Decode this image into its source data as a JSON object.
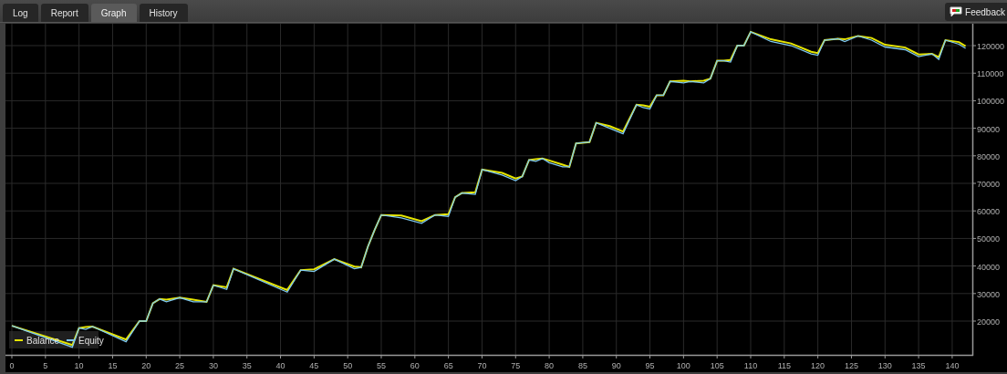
{
  "tabs": [
    {
      "label": "Log",
      "selected": false
    },
    {
      "label": "Report",
      "selected": false
    },
    {
      "label": "Graph",
      "selected": true
    },
    {
      "label": "History",
      "selected": false
    }
  ],
  "feedback_button": {
    "label": "Feedback"
  },
  "chart_data": {
    "type": "line",
    "x": [
      0,
      9,
      10,
      11,
      12,
      17,
      19,
      20,
      21,
      22,
      23,
      25,
      27,
      29,
      30,
      32,
      33,
      41,
      43,
      45,
      48,
      51,
      52,
      53,
      54,
      55,
      58,
      61,
      63,
      65,
      66,
      67,
      69,
      70,
      73,
      75,
      76,
      77,
      78,
      79,
      80,
      82,
      83,
      84,
      86,
      87,
      89,
      91,
      93,
      94,
      95,
      96,
      97,
      98,
      100,
      101,
      103,
      104,
      105,
      106,
      107,
      108,
      109,
      110,
      113,
      116,
      119,
      120,
      121,
      123,
      124,
      126,
      128,
      130,
      133,
      135,
      137,
      138,
      139,
      141,
      142
    ],
    "series": [
      {
        "name": "Balance",
        "color": "#e6e600",
        "values": [
          18300,
          11300,
          17500,
          17800,
          18000,
          13300,
          20000,
          20000,
          26500,
          28000,
          27800,
          28500,
          27800,
          27000,
          33000,
          32300,
          39000,
          31300,
          38500,
          38800,
          42500,
          39800,
          39500,
          47000,
          53000,
          58500,
          58300,
          56300,
          58500,
          58800,
          65000,
          66500,
          66800,
          75000,
          73800,
          71800,
          72500,
          78500,
          78800,
          79000,
          78300,
          76800,
          76000,
          84500,
          85000,
          92000,
          90800,
          88800,
          98500,
          98300,
          97800,
          102000,
          102000,
          107000,
          107300,
          107000,
          107300,
          108000,
          114500,
          114500,
          114800,
          120000,
          120000,
          125000,
          122300,
          120800,
          117800,
          117300,
          122000,
          122500,
          122300,
          123500,
          122800,
          120300,
          119300,
          116800,
          117000,
          115800,
          122000,
          121300,
          119800
        ]
      },
      {
        "name": "Equity",
        "color": "#7ec8f0",
        "values": [
          18300,
          10500,
          17500,
          17000,
          18000,
          12500,
          20000,
          20000,
          26500,
          28000,
          27000,
          28500,
          27000,
          27000,
          33000,
          31500,
          39000,
          30500,
          38500,
          38000,
          42500,
          39000,
          39500,
          47000,
          53000,
          58500,
          57500,
          55500,
          58500,
          58000,
          65000,
          66500,
          66000,
          75000,
          73000,
          71000,
          72500,
          78500,
          78000,
          79000,
          77500,
          76000,
          76000,
          84500,
          85000,
          92000,
          90000,
          88000,
          98500,
          97500,
          97000,
          102000,
          102000,
          107000,
          106500,
          107000,
          106500,
          108000,
          114500,
          114500,
          114000,
          120000,
          120000,
          125000,
          121500,
          120000,
          117000,
          116500,
          122000,
          122500,
          121500,
          123500,
          122000,
          119500,
          118500,
          116000,
          117000,
          115000,
          122000,
          120500,
          119000
        ]
      }
    ],
    "xlim": [
      -0.95,
      143
    ],
    "ylim": [
      7750,
      127950
    ],
    "grid": true,
    "legend": true,
    "xticks": [
      0,
      5,
      10,
      15,
      20,
      25,
      30,
      35,
      40,
      45,
      50,
      55,
      60,
      65,
      70,
      75,
      80,
      85,
      90,
      95,
      100,
      105,
      110,
      115,
      120,
      125,
      130,
      135,
      140
    ],
    "yticks": [
      20000,
      30000,
      40000,
      50000,
      60000,
      70000,
      80000,
      90000,
      100000,
      110000,
      120000
    ]
  }
}
